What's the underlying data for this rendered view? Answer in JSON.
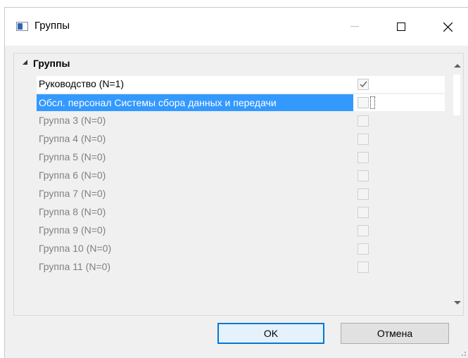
{
  "window": {
    "title": "Группы",
    "icons": {
      "app": "window-app-icon",
      "minimize": "minimize-icon",
      "maximize": "maximize-icon",
      "close": "close-icon"
    }
  },
  "tree": {
    "header": "Группы",
    "rows": [
      {
        "label": "Руководство (N=1)",
        "checked": true,
        "state": "active"
      },
      {
        "label": "Обсл. персонал Системы сбора данных и передачи",
        "checked": false,
        "state": "selected"
      },
      {
        "label": "Группа 3 (N=0)",
        "checked": false,
        "state": "disabled"
      },
      {
        "label": "Группа 4 (N=0)",
        "checked": false,
        "state": "disabled"
      },
      {
        "label": "Группа 5 (N=0)",
        "checked": false,
        "state": "disabled"
      },
      {
        "label": "Группа 6 (N=0)",
        "checked": false,
        "state": "disabled"
      },
      {
        "label": "Группа 7 (N=0)",
        "checked": false,
        "state": "disabled"
      },
      {
        "label": "Группа 8 (N=0)",
        "checked": false,
        "state": "disabled"
      },
      {
        "label": "Группа 9 (N=0)",
        "checked": false,
        "state": "disabled"
      },
      {
        "label": "Группа 10 (N=0)",
        "checked": false,
        "state": "disabled"
      },
      {
        "label": "Группа 11 (N=0)",
        "checked": false,
        "state": "disabled"
      }
    ]
  },
  "buttons": {
    "ok": "OK",
    "cancel": "Отмена"
  },
  "colors": {
    "selection": "#3399ff",
    "accent": "#0078d7",
    "disabled_text": "#808080"
  }
}
